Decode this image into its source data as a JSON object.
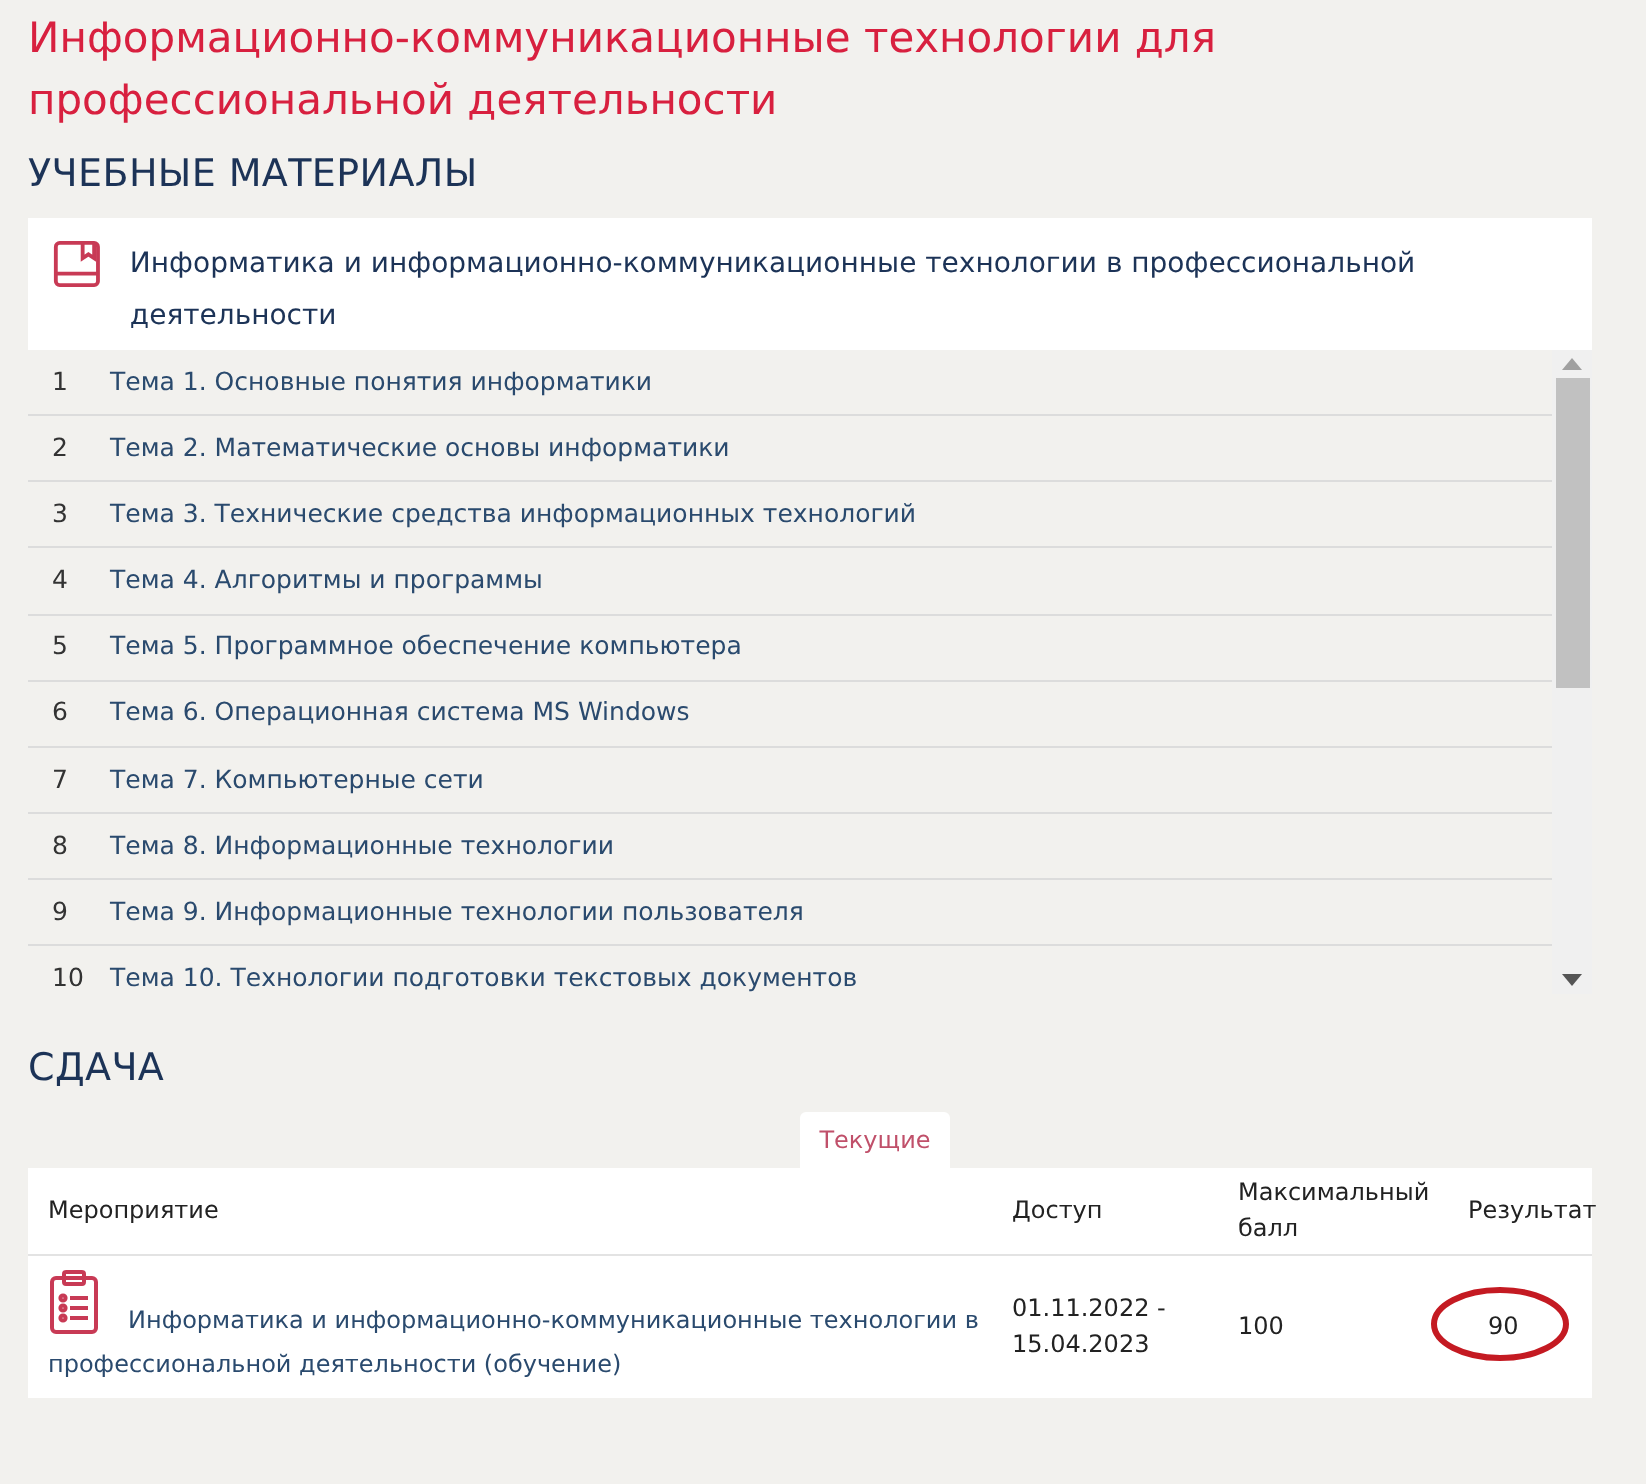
{
  "title": "Информационно-коммуникационные технологии для профессиональной деятельности",
  "materials": {
    "heading": "УЧЕБНЫЕ МАТЕРИАЛЫ",
    "course_title": "Информатика и информационно-коммуникационные технологии в профессиональной деятельности",
    "topics": [
      {
        "number": "1",
        "title": "Тема 1. Основные понятия информатики"
      },
      {
        "number": "2",
        "title": "Тема 2. Математические основы информатики"
      },
      {
        "number": "3",
        "title": "Тема 3. Технические средства информационных технологий"
      },
      {
        "number": "4",
        "title": "Тема 4. Алгоритмы и программы"
      },
      {
        "number": "5",
        "title": "Тема 5. Программное обеспечение компьютера"
      },
      {
        "number": "6",
        "title": "Тема 6. Операционная система MS Windows"
      },
      {
        "number": "7",
        "title": "Тема 7. Компьютерные сети"
      },
      {
        "number": "8",
        "title": "Тема 8. Информационные технологии"
      },
      {
        "number": "9",
        "title": "Тема 9. Информационные технологии пользователя"
      },
      {
        "number": "10",
        "title": "Тема 10. Технологии подготовки текстовых документов"
      }
    ]
  },
  "submission": {
    "heading": "СДАЧА",
    "tabs": [
      {
        "label": "Текущие",
        "selected": true
      }
    ],
    "columns": [
      "Мероприятие",
      "Доступ",
      "Максимальный балл",
      "Результат"
    ],
    "rows": [
      {
        "event": "Информатика и информационно-коммуникационные технологии в профессиональной деятельности (обучение)",
        "access": "01.11.2022 - 15.04.2023",
        "max_score": "100",
        "result": "90",
        "result_circled": true
      }
    ]
  }
}
